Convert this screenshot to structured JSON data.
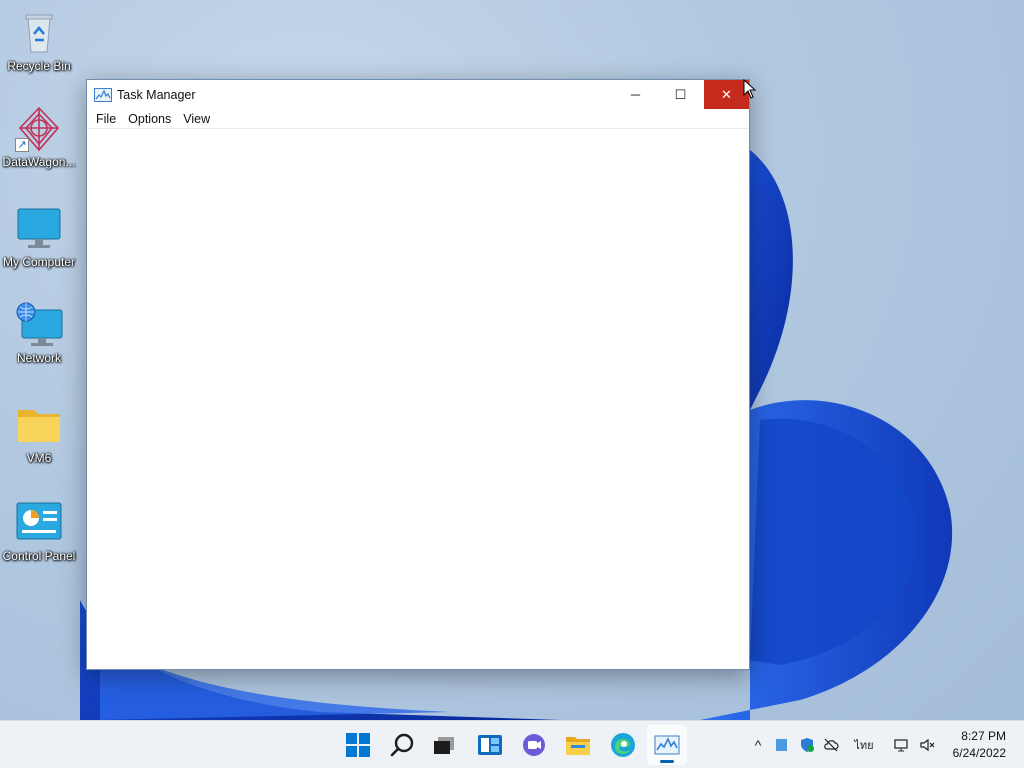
{
  "desktop": {
    "icons": [
      {
        "label": "Recycle Bin",
        "icon": "recycle-bin-icon"
      },
      {
        "label": "DataWagon...",
        "icon": "datawagon-icon"
      },
      {
        "label": "My Computer",
        "icon": "computer-icon"
      },
      {
        "label": "Network",
        "icon": "network-icon"
      },
      {
        "label": "VM6",
        "icon": "folder-icon"
      },
      {
        "label": "Control Panel",
        "icon": "control-panel-icon"
      }
    ]
  },
  "window": {
    "title": "Task Manager",
    "icon": "task-manager-icon",
    "controls": {
      "minimize": "─",
      "maximize": "☐",
      "close": "✕"
    },
    "menu": [
      "File",
      "Options",
      "View"
    ]
  },
  "taskbar": {
    "pinned": [
      "start-icon",
      "search-icon",
      "task-view-icon",
      "widgets-icon",
      "chat-icon",
      "file-explorer-icon",
      "edge-icon",
      "task-manager-icon"
    ],
    "tray": {
      "chevron": "^",
      "language": "ไทย",
      "time": "8:27 PM",
      "date": "6/24/2022"
    },
    "colors": {
      "accent": "#0063b1",
      "close": "#c42b1c"
    }
  }
}
